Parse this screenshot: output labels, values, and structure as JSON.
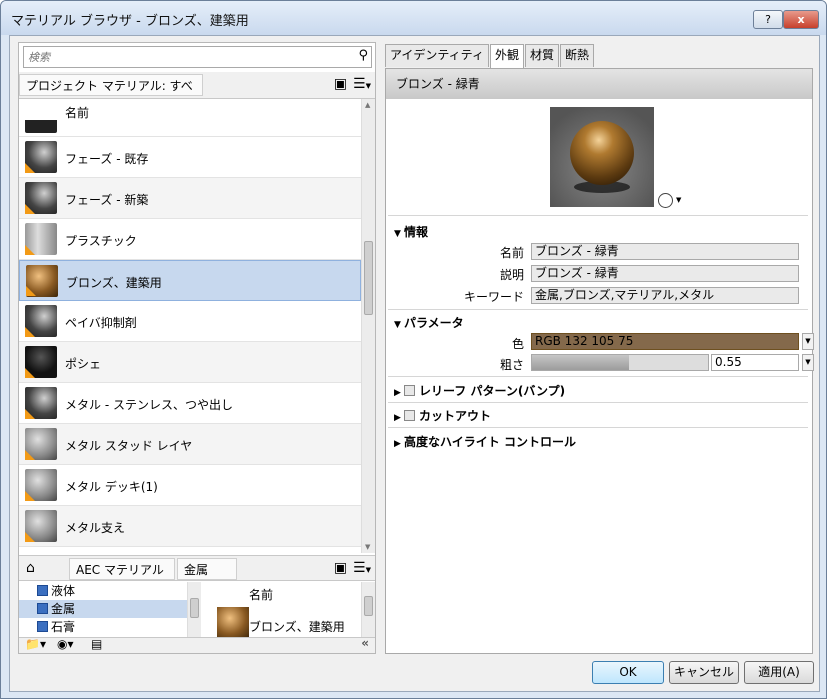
{
  "window": {
    "title": "マテリアル ブラウザ - ブロンズ、建築用",
    "help": "?",
    "close": "x"
  },
  "search": {
    "placeholder": "検索"
  },
  "project_crumb": "プロジェクト マテリアル: すべて",
  "materials": {
    "header": "名前",
    "items": [
      {
        "label": "フェーズ - 既存",
        "thumb": "dark"
      },
      {
        "label": "フェーズ - 新築",
        "thumb": "dark"
      },
      {
        "label": "プラスチック",
        "thumb": "cyl"
      },
      {
        "label": "ブロンズ、建築用",
        "thumb": "bronze",
        "selected": true
      },
      {
        "label": "ペイバ抑制剤",
        "thumb": "dark"
      },
      {
        "label": "ポシェ",
        "thumb": "black"
      },
      {
        "label": "メタル - ステンレス、つや出し",
        "thumb": "dark"
      },
      {
        "label": "メタル スタッド レイヤ",
        "thumb": "gray"
      },
      {
        "label": "メタル デッキ(1)",
        "thumb": "gray"
      },
      {
        "label": "メタル支え",
        "thumb": "gray"
      }
    ]
  },
  "library": {
    "crumbs": [
      "AEC マテリアル",
      "金属"
    ],
    "tree": [
      {
        "label": "液体"
      },
      {
        "label": "金属",
        "selected": true
      },
      {
        "label": "石膏"
      }
    ],
    "grid_header": "名前",
    "grid_item": "ブロンズ、建築用",
    "collapse": "«"
  },
  "tabs": [
    "アイデンティティ",
    "外観",
    "材質",
    "断熱"
  ],
  "active_tab": "外観",
  "asset_name": "ブロンズ - 緑青",
  "info": {
    "title": "情報",
    "name_label": "名前",
    "name_value": "ブロンズ - 緑青",
    "desc_label": "説明",
    "desc_value": "ブロンズ - 緑青",
    "kw_label": "キーワード",
    "kw_value": "金属,ブロンズ,マテリアル,メタル"
  },
  "params": {
    "title": "パラメータ",
    "color_label": "色",
    "color_value": "RGB 132 105 75",
    "color_hex": "#84694b",
    "rough_label": "粗さ",
    "rough_value": "0.55",
    "rough_fraction": 0.55
  },
  "sections": [
    "レリーフ パターン(バンプ)",
    "カットアウト",
    "高度なハイライト コントロール"
  ],
  "buttons": {
    "ok": "OK",
    "cancel": "キャンセル",
    "apply": "適用(A)"
  }
}
